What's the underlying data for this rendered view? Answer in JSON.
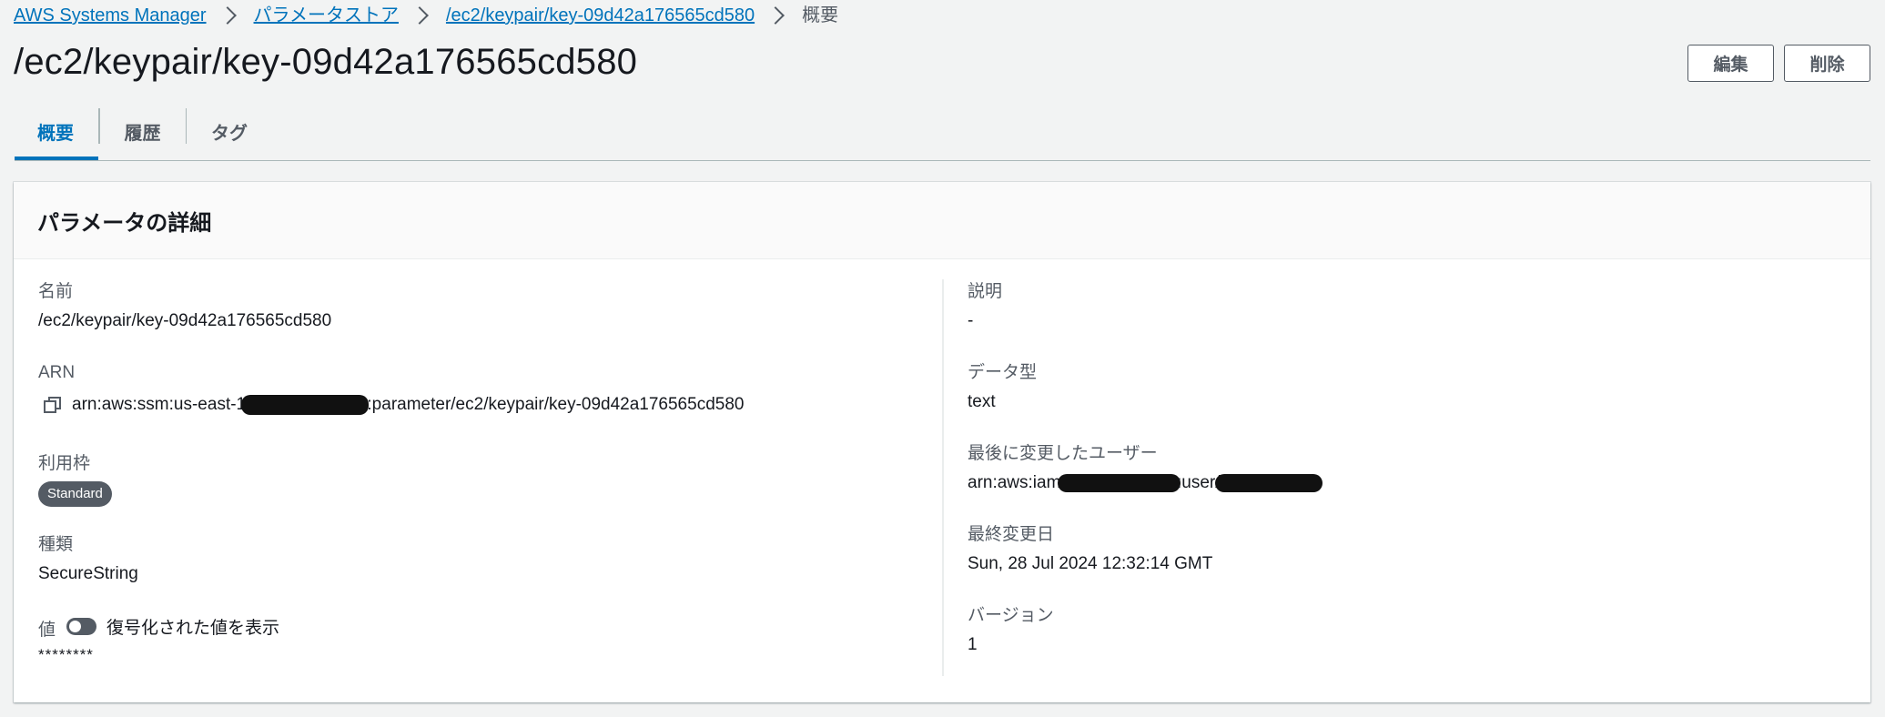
{
  "breadcrumb": {
    "items": [
      "AWS Systems Manager",
      "パラメータストア",
      "/ec2/keypair/key-09d42a176565cd580"
    ],
    "current": "概要"
  },
  "page": {
    "title": "/ec2/keypair/key-09d42a176565cd580"
  },
  "actions": {
    "edit_label": "編集",
    "delete_label": "削除"
  },
  "tabs": [
    {
      "label": "概要",
      "active": true
    },
    {
      "label": "履歴",
      "active": false
    },
    {
      "label": "タグ",
      "active": false
    }
  ],
  "details": {
    "header": "パラメータの詳細",
    "name": {
      "label": "名前",
      "value": "/ec2/keypair/key-09d42a176565cd580"
    },
    "arn": {
      "label": "ARN",
      "prefix": "arn:aws:ssm:us-east-1:",
      "suffix": ":parameter/ec2/keypair/key-09d42a176565cd580"
    },
    "tier": {
      "label": "利用枠",
      "value": "Standard"
    },
    "type": {
      "label": "種類",
      "value": "SecureString"
    },
    "value": {
      "label": "値",
      "toggle_label": "復号化された値を表示",
      "masked": "********",
      "toggle_on": false
    },
    "description": {
      "label": "説明",
      "value": "-"
    },
    "data_type": {
      "label": "データ型",
      "value": "text"
    },
    "last_modified_user": {
      "label": "最後に変更したユーザー",
      "prefix": "arn:aws:iam::",
      "middle": ":user/"
    },
    "last_modified_date": {
      "label": "最終変更日",
      "value": "Sun, 28 Jul 2024 12:32:14 GMT"
    },
    "version": {
      "label": "バージョン",
      "value": "1"
    }
  },
  "colors": {
    "accent": "#0073bb",
    "badge_bg": "#545b64",
    "background": "#f2f3f3"
  },
  "icons": {
    "breadcrumb_separator": "chevron-right-icon",
    "copy": "copy-icon",
    "toggle": "toggle-switch"
  }
}
